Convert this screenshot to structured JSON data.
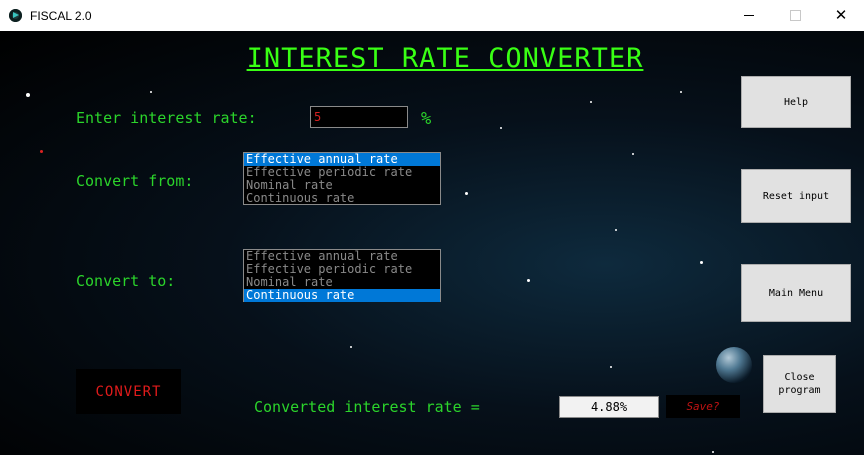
{
  "window": {
    "title": "FISCAL 2.0",
    "minimize": "—",
    "maximize": "☐",
    "close": "✕"
  },
  "main": {
    "heading": "INTEREST RATE CONVERTER",
    "rate_label": "Enter interest rate:",
    "rate_value": "5",
    "percent_sign": "%",
    "from_label": "Convert from:",
    "to_label": "Convert to:",
    "from_options": [
      {
        "label": "Effective annual rate",
        "selected": true
      },
      {
        "label": "Effective periodic rate",
        "selected": false
      },
      {
        "label": "Nominal rate",
        "selected": false
      },
      {
        "label": "Continuous rate",
        "selected": false
      }
    ],
    "to_options": [
      {
        "label": "Effective annual rate",
        "selected": false
      },
      {
        "label": "Effective periodic rate",
        "selected": false
      },
      {
        "label": "Nominal rate",
        "selected": false
      },
      {
        "label": "Continuous rate",
        "selected": true
      }
    ],
    "convert_label": "CONVERT",
    "result_label": "Converted interest rate =",
    "result_value": "4.88%",
    "save_label": "Save?"
  },
  "side": {
    "help": "Help",
    "reset": "Reset input",
    "main_menu": "Main Menu",
    "close_program": "Close program"
  },
  "colors": {
    "label_green": "#2bd42b",
    "heading_green": "#39ff14",
    "selection_blue": "#0078d7",
    "convert_red": "#e01b1b"
  }
}
